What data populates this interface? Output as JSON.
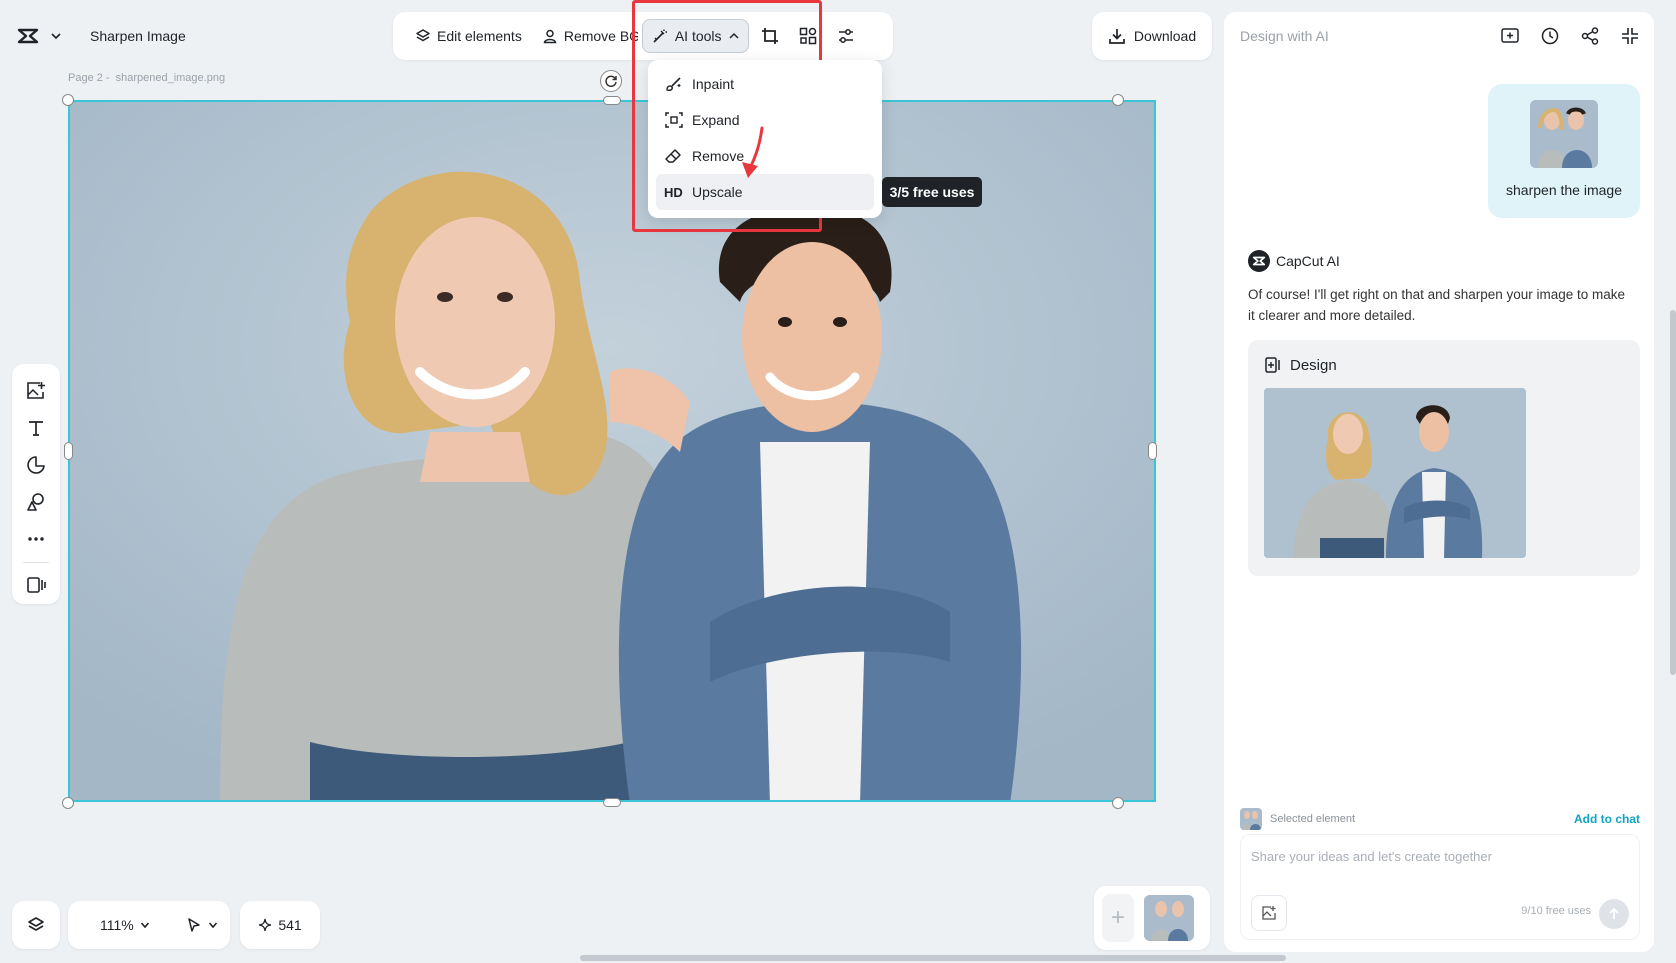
{
  "header": {
    "title": "Sharpen Image"
  },
  "toolbar": {
    "edit_elements": "Edit elements",
    "remove_bg": "Remove BG",
    "ai_tools": "AI tools"
  },
  "ai_menu": {
    "items": [
      {
        "label": "Inpaint",
        "icon": "brush-sparkle-icon"
      },
      {
        "label": "Expand",
        "icon": "expand-frame-icon"
      },
      {
        "label": "Remove",
        "icon": "eraser-icon"
      },
      {
        "label": "Upscale",
        "icon": "hd-badge",
        "badge": "HD"
      }
    ],
    "tooltip": "3/5 free uses"
  },
  "download": {
    "label": "Download"
  },
  "page": {
    "label": "Page 2 -",
    "filename": "sharpened_image.png"
  },
  "bottom": {
    "zoom": "111%",
    "credits": "541"
  },
  "panel": {
    "title": "Design with AI",
    "user_message": "sharpen the image",
    "ai_name": "CapCut AI",
    "ai_message": "Of course! I'll get right on that and sharpen your image to make it clearer and more detailed.",
    "design_title": "Design",
    "selected_label": "Selected element",
    "add_to_chat": "Add to chat",
    "input_placeholder": "Share your ideas and let's create together",
    "free_uses": "9/10 free uses"
  },
  "colors": {
    "accent": "#3bc6d8",
    "highlight": "#e8373d",
    "link": "#11a3c2"
  }
}
